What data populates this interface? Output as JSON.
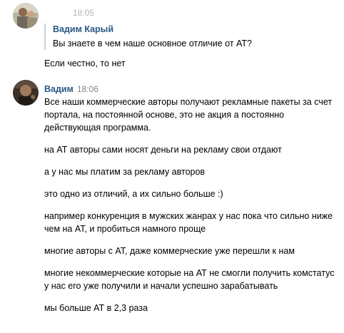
{
  "messages": [
    {
      "author": "",
      "time": "18:05",
      "quote": {
        "author": "Вадим Карый",
        "text": "Вы знаете в чем наше основное отличие от АТ?"
      },
      "text": "Если честно, то нет"
    },
    {
      "author": "Вадим",
      "time": "18:06",
      "paragraphs": [
        "Все наши коммерческие авторы получают рекламные пакеты за счет портала, на постоянной основе, это не акция а постоянно действующая программа.",
        "на АТ авторы сами носят деньги на рекламу свои отдают",
        "а у нас мы платим за рекламу авторов",
        "это одно из отличий, а их сильно больше :)",
        "например конкуренция в мужских жанрах у нас пока что сильно ниже чем на АТ, и пробиться намного проще",
        "многие авторы с АТ, даже коммерческие уже перешли к нам",
        "многие некоммерческие которые на АТ не смогли получить комстатус у нас его уже получили и начали успешно зарабатывать",
        "мы больше АТ в 2,3 раза"
      ]
    }
  ]
}
